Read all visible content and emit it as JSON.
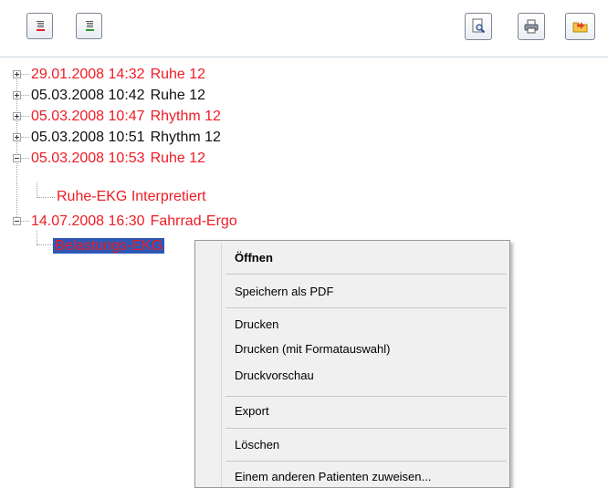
{
  "toolbar": {
    "left_buttons": [
      {
        "name": "collapse-all-button",
        "icon": "collapse-list-red-icon"
      },
      {
        "name": "expand-all-button",
        "icon": "expand-list-green-icon"
      }
    ],
    "right_buttons": [
      {
        "name": "print-preview-button",
        "icon": "magnifier-page-icon"
      },
      {
        "name": "print-button",
        "icon": "printer-icon"
      },
      {
        "name": "export-button",
        "icon": "folder-arrow-icon"
      }
    ]
  },
  "tree": {
    "items": [
      {
        "date": "29.01.2008 14:32",
        "label": "Ruhe 12",
        "color": "#ee1c24",
        "expanded": false
      },
      {
        "date": "05.03.2008 10:42",
        "label": "Ruhe 12",
        "color": "#111111",
        "expanded": false
      },
      {
        "date": "05.03.2008 10:47",
        "label": "Rhythm 12",
        "color": "#ee1c24",
        "expanded": false
      },
      {
        "date": "05.03.2008 10:51",
        "label": "Rhythm 12",
        "color": "#111111",
        "expanded": false
      },
      {
        "date": "05.03.2008 10:53",
        "label": "Ruhe 12",
        "color": "#ee1c24",
        "expanded": true,
        "children": [
          {
            "label": "Ruhe-EKG Interpretiert",
            "color": "#ee1c24"
          }
        ]
      },
      {
        "date": "14.07.2008 16:30",
        "label": "Fahrrad-Ergo",
        "color": "#ee1c24",
        "expanded": true,
        "children": [
          {
            "label": "Belastungs-EKG",
            "color": "#ee1c24",
            "selected": true
          }
        ]
      }
    ]
  },
  "context_menu": {
    "items": [
      {
        "label": "Öffnen",
        "bold": true
      },
      {
        "label": "Speichern als PDF"
      },
      {
        "label": "Drucken"
      },
      {
        "label": "Drucken (mit Formatauswahl)"
      },
      {
        "label": "Druckvorschau"
      },
      {
        "label": "Export"
      },
      {
        "label": "Löschen"
      },
      {
        "label": "Einem anderen Patienten zuweisen..."
      }
    ]
  }
}
